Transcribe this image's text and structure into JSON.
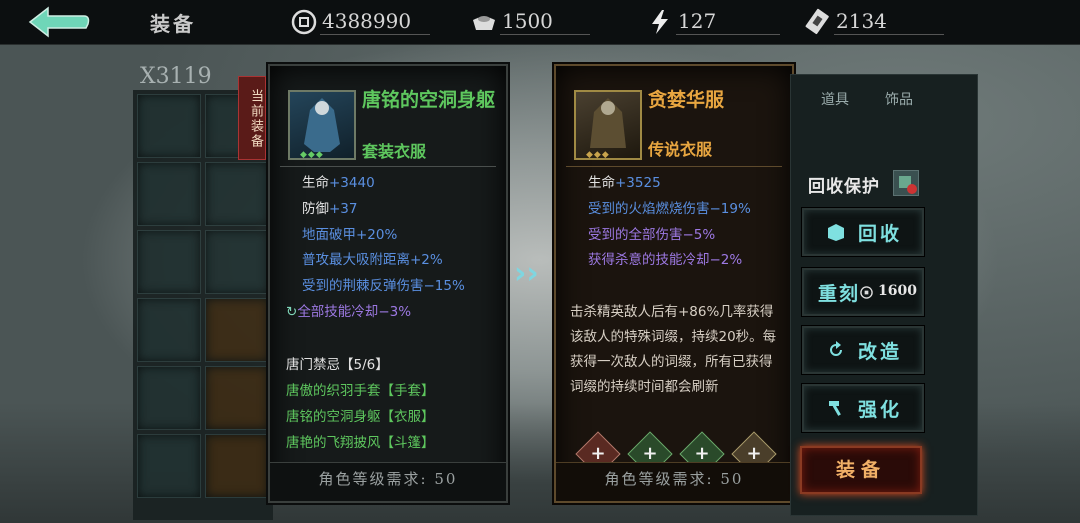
{
  "topbar": {
    "title": "装备",
    "resources": [
      {
        "icon": "coin-icon",
        "value": "4388990"
      },
      {
        "icon": "ingot-icon",
        "value": "1500"
      },
      {
        "icon": "lightning-icon",
        "value": "127"
      },
      {
        "icon": "ticket-icon",
        "value": "2134"
      }
    ]
  },
  "inventory": {
    "count_label": "X3119"
  },
  "current": {
    "tag": "当前装备",
    "name": "唐铭的空洞身躯",
    "type": "套装衣服",
    "stats": [
      {
        "label": "生命",
        "bonus": "+3440",
        "color": "white"
      },
      {
        "label": "防御",
        "bonus": "+37",
        "color": "white"
      },
      {
        "label": "地面破甲",
        "bonus": "+20%",
        "color": "blue"
      },
      {
        "label": "普攻最大吸附距离",
        "bonus": "+2%",
        "color": "blue"
      },
      {
        "label": "受到的荆棘反弹伤害",
        "bonus": "−15%",
        "color": "blue"
      },
      {
        "label": "全部技能冷却",
        "bonus": "−3%",
        "color": "purple"
      }
    ],
    "set_title": "唐门禁忌【5/6】",
    "set_items": [
      "唐傲的织羽手套【手套】",
      "唐铭的空洞身躯【衣服】",
      "唐艳的飞翔披风【斗篷】"
    ],
    "requirement": "角色等级需求: 50"
  },
  "candidate": {
    "name": "贪婪华服",
    "type": "传说衣服",
    "stats": [
      {
        "label": "生命",
        "bonus": "+3525",
        "color": "white"
      },
      {
        "label": "受到的火焰燃烧伤害",
        "bonus": "−19%",
        "color": "blue"
      },
      {
        "label": "受到的全部伤害",
        "bonus": "−5%",
        "color": "purple"
      },
      {
        "label": "获得杀意的技能冷却",
        "bonus": "−2%",
        "color": "purple"
      }
    ],
    "description": "击杀精英敌人后有+86%几率获得该敌人的特殊词缀，持续20秒。每获得一次敌人的词缀，所有已获得词缀的持续时间都会刷新",
    "requirement": "角色等级需求: 50"
  },
  "actions": {
    "columns": [
      "道具",
      "饰品"
    ],
    "protect_label": "回收保护",
    "recycle": "回收",
    "reforge": "重刻",
    "reforge_cost": "1600",
    "modify": "改造",
    "enhance": "强化",
    "equip": "装备"
  },
  "colors": {
    "green": "#5ec75e",
    "blue": "#5a8fe0",
    "purple": "#9d79e3",
    "gold": "#e8a640"
  }
}
